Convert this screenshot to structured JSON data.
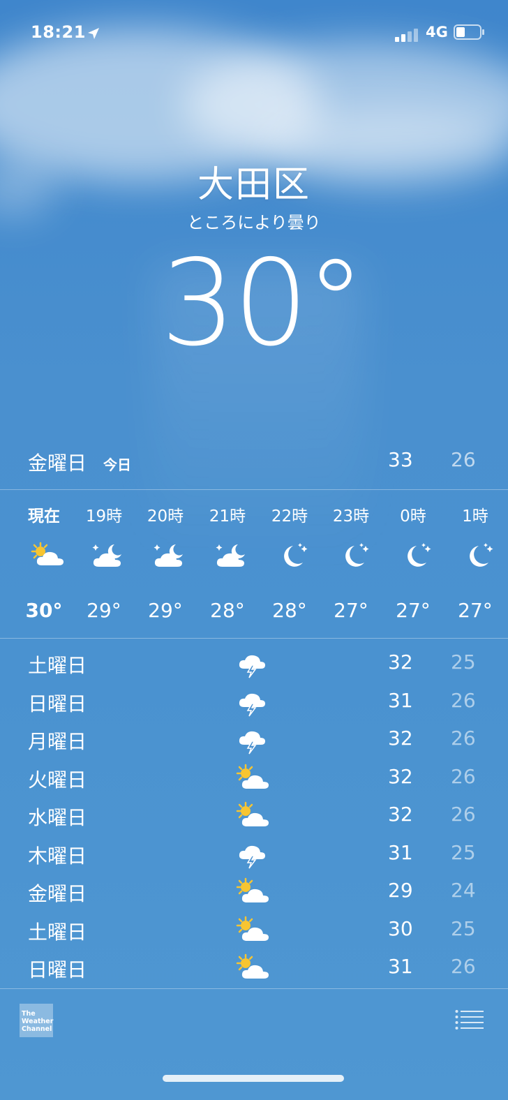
{
  "status_bar": {
    "time": "18:21",
    "network": "4G"
  },
  "location": {
    "city": "大田区",
    "condition": "ところにより曇り",
    "temperature": "30°"
  },
  "today": {
    "day": "金曜日",
    "tag": "今日",
    "high": "33",
    "low": "26"
  },
  "hourly": [
    {
      "label": "現在",
      "icon": "partly-sunny-icon",
      "temp": "30°"
    },
    {
      "label": "19時",
      "icon": "partly-cloudy-night-icon",
      "temp": "29°"
    },
    {
      "label": "20時",
      "icon": "partly-cloudy-night-icon",
      "temp": "29°"
    },
    {
      "label": "21時",
      "icon": "partly-cloudy-night-icon",
      "temp": "28°"
    },
    {
      "label": "22時",
      "icon": "moon-stars-icon",
      "temp": "28°"
    },
    {
      "label": "23時",
      "icon": "moon-stars-icon",
      "temp": "27°"
    },
    {
      "label": "0時",
      "icon": "moon-stars-icon",
      "temp": "27°"
    },
    {
      "label": "1時",
      "icon": "moon-stars-icon",
      "temp": "27°"
    }
  ],
  "daily": [
    {
      "day": "土曜日",
      "icon": "thunderstorm-icon",
      "high": "32",
      "low": "25"
    },
    {
      "day": "日曜日",
      "icon": "thunderstorm-icon",
      "high": "31",
      "low": "26"
    },
    {
      "day": "月曜日",
      "icon": "thunderstorm-icon",
      "high": "32",
      "low": "26"
    },
    {
      "day": "火曜日",
      "icon": "partly-sunny-icon",
      "high": "32",
      "low": "26"
    },
    {
      "day": "水曜日",
      "icon": "partly-sunny-icon",
      "high": "32",
      "low": "26"
    },
    {
      "day": "木曜日",
      "icon": "thunderstorm-icon",
      "high": "31",
      "low": "25"
    },
    {
      "day": "金曜日",
      "icon": "partly-sunny-icon",
      "high": "29",
      "low": "24"
    },
    {
      "day": "土曜日",
      "icon": "partly-sunny-icon",
      "high": "30",
      "low": "25"
    },
    {
      "day": "日曜日",
      "icon": "partly-sunny-icon",
      "high": "31",
      "low": "26"
    }
  ],
  "footer": {
    "logo_text": "The Weather Channel"
  },
  "colors": {
    "sun": "#f7c531",
    "sky": "#4a90cf"
  }
}
